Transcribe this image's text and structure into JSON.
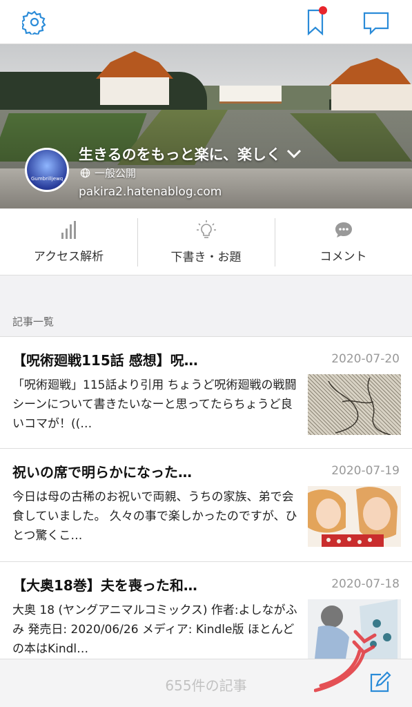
{
  "topbar": {
    "settings_icon": "gear-icon",
    "bookmark_icon": "bookmark-icon",
    "comment_icon": "speech-bubble-icon",
    "notification_color": "#e8242b",
    "accent": "#2a8bd8"
  },
  "blog": {
    "title": "生きるのをもっと楽に、楽しく",
    "visibility": "一般公開",
    "domain": "pakira2.hatenablog.com",
    "avatar_text": "Gumbrilljewq"
  },
  "actions": [
    {
      "label": "アクセス解析",
      "icon": "bar-chart-icon"
    },
    {
      "label": "下書き・お題",
      "icon": "lightbulb-icon"
    },
    {
      "label": "コメント",
      "icon": "chat-icon"
    }
  ],
  "section": {
    "label": "記事一覧"
  },
  "entries": [
    {
      "title": "【呪術廻戦115話 感想】呪…",
      "date": "2020-07-20",
      "body": "「呪術廻戦」115話より引用 ちょうど呪術廻戦の戦闘シーンについて書きたいなーと思ってたらちょうど良いコマが！((…"
    },
    {
      "title": "祝いの席で明らかになった…",
      "date": "2020-07-19",
      "body": "今日は母の古稀のお祝いで両親、うちの家族、弟で会食していました。 久々の事で楽しかったのですが、ひとつ驚くこ…"
    },
    {
      "title": "【大奥18巻】夫を喪った和…",
      "date": "2020-07-18",
      "body": "大奥 18 (ヤングアニマルコミックス) 作者:よしながふみ 発売日: 2020/06/26 メディア: Kindle版 ほとんどの本はKindl…"
    }
  ],
  "footer": {
    "count": "655件の記事",
    "compose_icon": "compose-icon"
  }
}
